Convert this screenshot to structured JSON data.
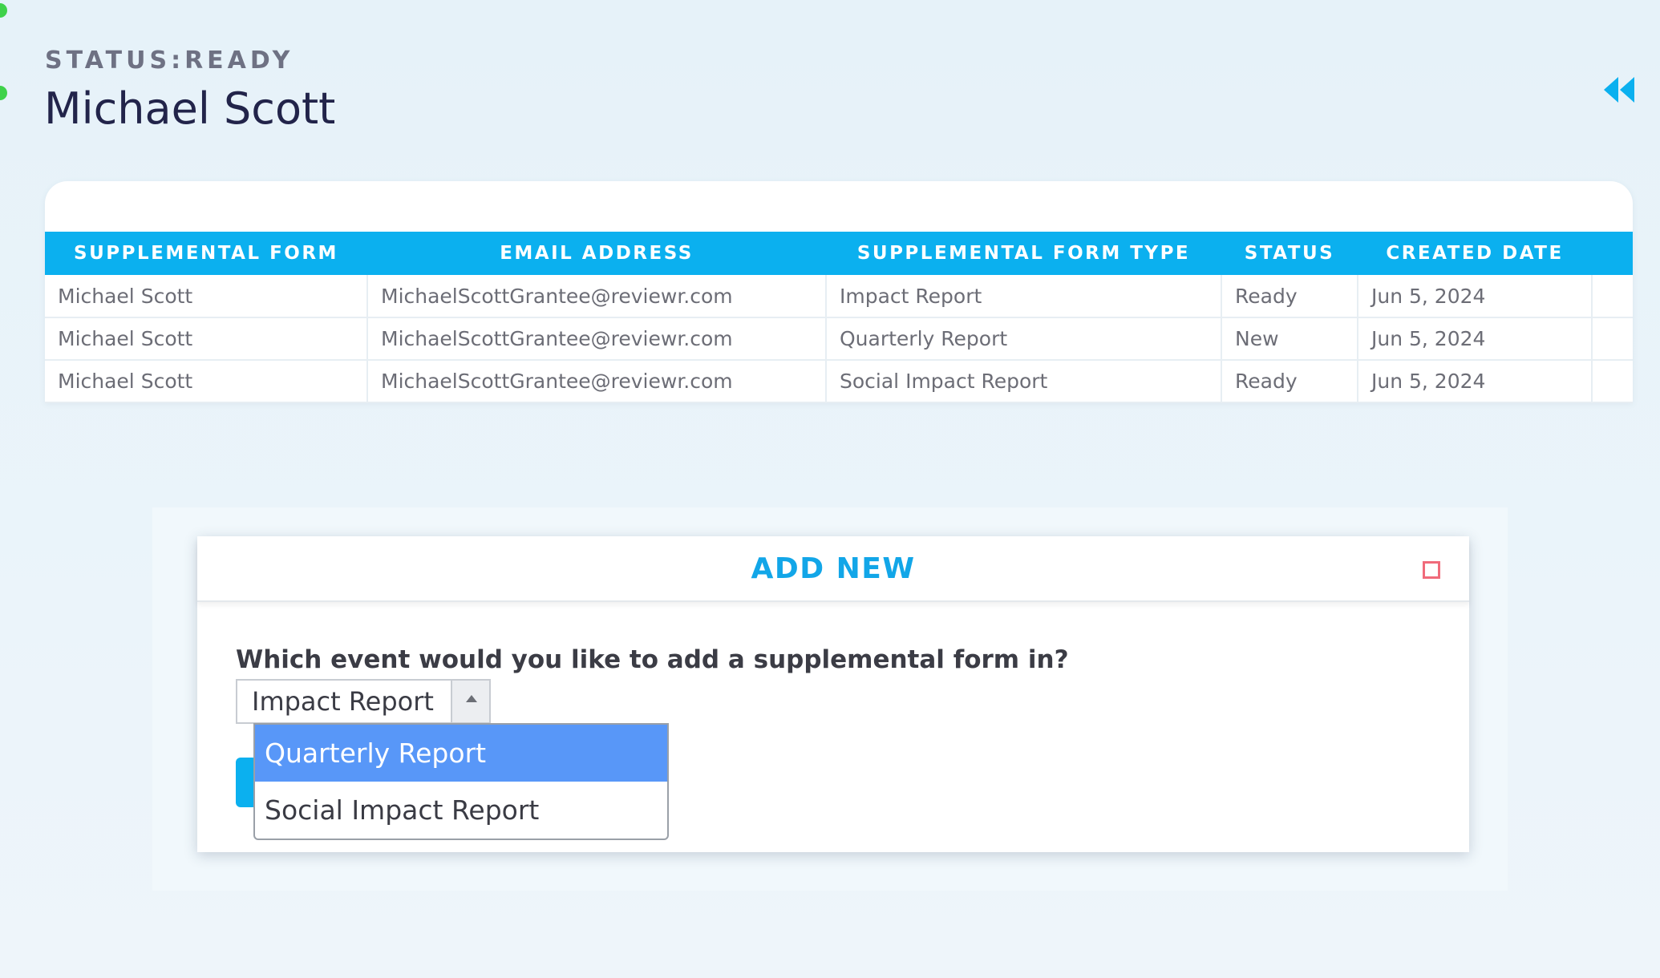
{
  "header": {
    "status_label": "STATUS",
    "status_separator": ":",
    "status_value": "READY",
    "title": "Michael Scott",
    "back_icon": "double-chevron-left-icon"
  },
  "table": {
    "columns": [
      "SUPPLEMENTAL FORM",
      "EMAIL ADDRESS",
      "SUPPLEMENTAL FORM TYPE",
      "STATUS",
      "CREATED DATE"
    ],
    "rows": [
      [
        "Michael Scott",
        "MichaelScottGrantee@reviewr.com",
        "Impact Report",
        "Ready",
        "Jun 5, 2024"
      ],
      [
        "Michael Scott",
        "MichaelScottGrantee@reviewr.com",
        "Quarterly Report",
        "New",
        "Jun 5, 2024"
      ],
      [
        "Michael Scott",
        "MichaelScottGrantee@reviewr.com",
        "Social Impact Report",
        "Ready",
        "Jun 5, 2024"
      ]
    ]
  },
  "modal": {
    "title": "ADD NEW",
    "close_icon": "close-icon",
    "question": "Which event would you like to add a supplemental form in?",
    "select": {
      "value": "Impact Report",
      "options": [
        "Quarterly Report",
        "Social Impact Report"
      ],
      "highlighted": "Quarterly Report"
    }
  },
  "colors": {
    "accent": "#0bb0ef",
    "title": "#22244a",
    "highlight": "#5897f8",
    "close": "#f06b7b"
  }
}
